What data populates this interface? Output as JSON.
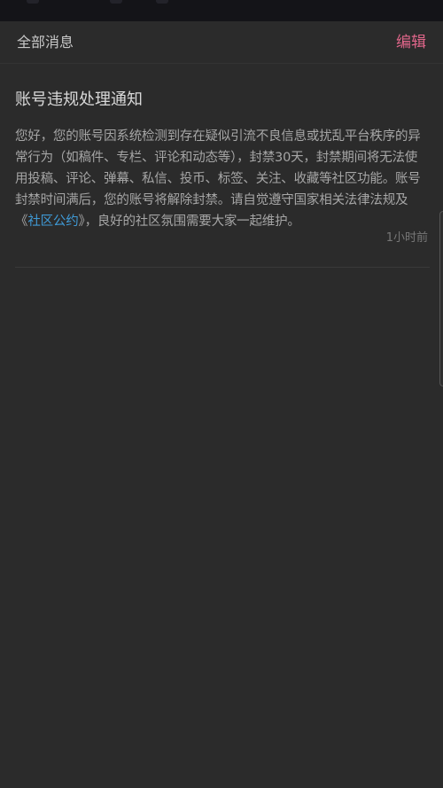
{
  "header": {
    "title": "全部消息",
    "edit_label": "编辑"
  },
  "message": {
    "title": "账号违规处理通知",
    "body_before": "您好，您的账号因系统检测到存在疑似引流不良信息或扰乱平台秩序的异常行为（如稿件、专栏、评论和动态等），封禁30天，封禁期间将无法使用投稿、评论、弹幕、私信、投币、标签、关注、收藏等社区功能。账号封禁时间满后，您的账号将解除封禁。请自觉遵守国家相关法律法规及《",
    "link_text": "社区公约",
    "body_after": "》，良好的社区氛围需要大家一起维护。",
    "time": "1小时前"
  },
  "colors": {
    "background": "#2b2b2b",
    "status_bar": "#141418",
    "accent_pink": "#e0668a",
    "link_blue": "#3f9ad6"
  }
}
